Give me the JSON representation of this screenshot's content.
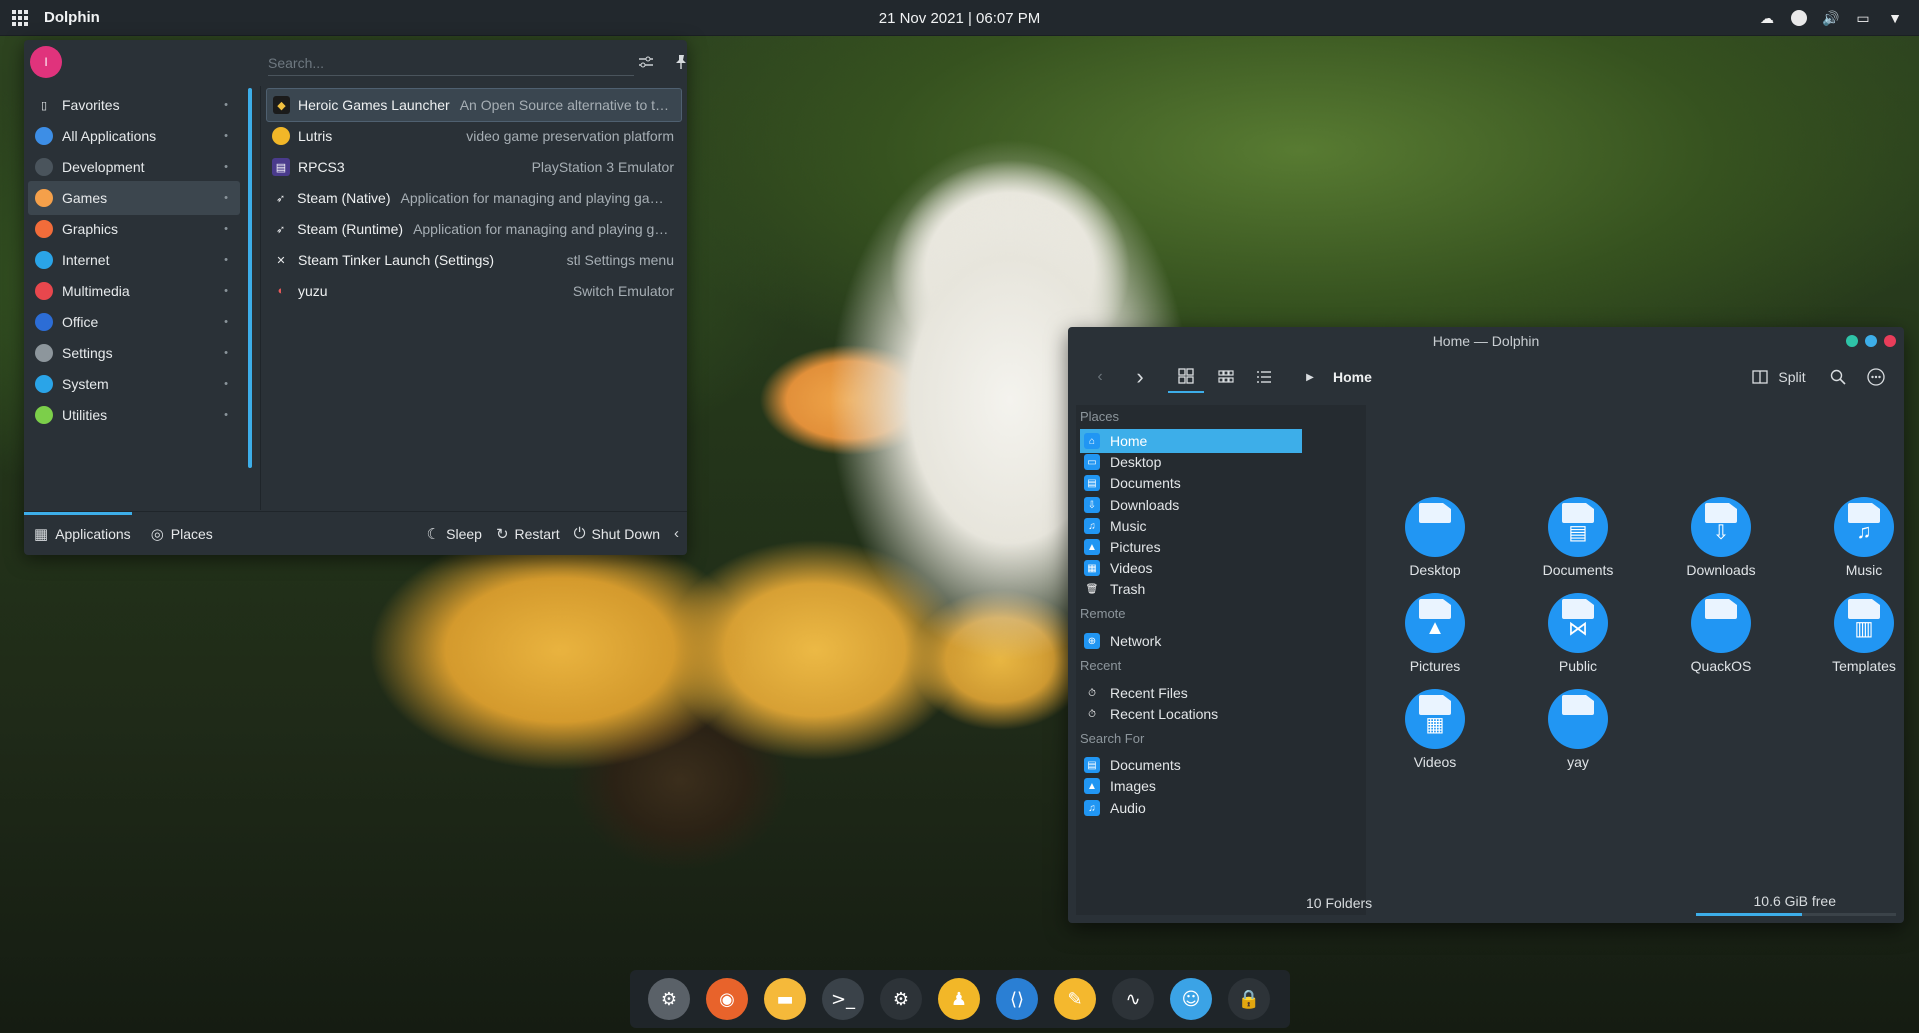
{
  "top_panel": {
    "active_app": "Dolphin",
    "clock": "21 Nov 2021 | 06:07 PM",
    "icons": [
      "app-grid-icon",
      "cloud-icon",
      "steam-tray-icon",
      "volume-icon",
      "display-icon",
      "chevron-down-icon"
    ]
  },
  "launcher": {
    "avatar_initial": "I",
    "search_placeholder": "Search...",
    "categories": [
      {
        "label": "Favorites",
        "icon": "bookmark-icon",
        "color": "#2a3137"
      },
      {
        "label": "All Applications",
        "icon": "grid-icon",
        "color": "#3d8ee6"
      },
      {
        "label": "Development",
        "icon": "development-icon",
        "color": "#4a545c"
      },
      {
        "label": "Games",
        "icon": "games-icon",
        "color": "#f5a04a"
      },
      {
        "label": "Graphics",
        "icon": "graphics-icon",
        "color": "#f26c3a"
      },
      {
        "label": "Internet",
        "icon": "internet-icon",
        "color": "#2aa4e8"
      },
      {
        "label": "Multimedia",
        "icon": "multimedia-icon",
        "color": "#e8474d"
      },
      {
        "label": "Office",
        "icon": "office-icon",
        "color": "#2c6dd6"
      },
      {
        "label": "Settings",
        "icon": "settings-icon",
        "color": "#8d969c"
      },
      {
        "label": "System",
        "icon": "system-icon",
        "color": "#2aa4e8"
      },
      {
        "label": "Utilities",
        "icon": "utilities-icon",
        "color": "#7ccf4a"
      }
    ],
    "selected_category": "Games",
    "apps": [
      {
        "name": "Heroic Games Launcher",
        "desc": "An Open Source alternative to the ...",
        "icon": "heroic-icon",
        "color": "#1b1b1b"
      },
      {
        "name": "Lutris",
        "desc": "video game preservation platform",
        "icon": "lutris-icon",
        "color": "#f2b728"
      },
      {
        "name": "RPCS3",
        "desc": "PlayStation 3 Emulator",
        "icon": "rpcs3-icon",
        "color": "#4a3b8c"
      },
      {
        "name": "Steam (Native)",
        "desc": "Application for managing and playing games...",
        "icon": "steam-icon",
        "color": "#2a3137"
      },
      {
        "name": "Steam (Runtime)",
        "desc": "Application for managing and playing gam...",
        "icon": "steam-icon",
        "color": "#2a3137"
      },
      {
        "name": "Steam Tinker Launch (Settings)",
        "desc": "stl Settings menu",
        "icon": "steam-tinker-icon",
        "color": "#2a3137"
      },
      {
        "name": "yuzu",
        "desc": "Switch Emulator",
        "icon": "yuzu-icon",
        "color": "#2a3137"
      }
    ],
    "footer": {
      "applications": "Applications",
      "places": "Places",
      "sleep": "Sleep",
      "restart": "Restart",
      "shutdown": "Shut Down"
    }
  },
  "dolphin": {
    "title": "Home — Dolphin",
    "breadcrumb": "Home",
    "split_label": "Split",
    "places_sections": [
      {
        "header": "Places",
        "items": [
          "Home",
          "Desktop",
          "Documents",
          "Downloads",
          "Music",
          "Pictures",
          "Videos",
          "Trash"
        ]
      },
      {
        "header": "Remote",
        "items": [
          "Network"
        ]
      },
      {
        "header": "Recent",
        "items": [
          "Recent Files",
          "Recent Locations"
        ]
      },
      {
        "header": "Search For",
        "items": [
          "Documents",
          "Images",
          "Audio"
        ]
      }
    ],
    "active_place": "Home",
    "folders": [
      {
        "name": "Desktop",
        "glyph": ""
      },
      {
        "name": "Documents",
        "glyph": "▤"
      },
      {
        "name": "Downloads",
        "glyph": "⇩"
      },
      {
        "name": "Music",
        "glyph": "♫"
      },
      {
        "name": "Pictures",
        "glyph": "▲"
      },
      {
        "name": "Public",
        "glyph": "⋈"
      },
      {
        "name": "QuackOS",
        "glyph": ""
      },
      {
        "name": "Templates",
        "glyph": "▥"
      },
      {
        "name": "Videos",
        "glyph": "▦"
      },
      {
        "name": "yay",
        "glyph": ""
      }
    ],
    "status_count": "10 Folders",
    "status_free": "10.6 GiB free",
    "disk_used_fraction": 0.53
  },
  "dock": [
    {
      "name": "system-settings",
      "icon": "settings-gear-icon",
      "color": "#5a6168",
      "glyph": "⚙"
    },
    {
      "name": "firefox",
      "icon": "firefox-icon",
      "color": "#e8632b",
      "glyph": "◉"
    },
    {
      "name": "dolphin",
      "icon": "folder-icon",
      "color": "#f5b93a",
      "glyph": "▬"
    },
    {
      "name": "konsole",
      "icon": "terminal-icon",
      "color": "#3a4249",
      "glyph": ">_"
    },
    {
      "name": "steam",
      "icon": "steam-icon",
      "color": "#2d3338",
      "glyph": "⚙"
    },
    {
      "name": "lutris",
      "icon": "lutris-icon",
      "color": "#f2b728",
      "glyph": "♟"
    },
    {
      "name": "vscode",
      "icon": "vscode-icon",
      "color": "#2a7fd4",
      "glyph": "⟨⟩"
    },
    {
      "name": "kate",
      "icon": "pencil-icon",
      "color": "#f4b82e",
      "glyph": "✎"
    },
    {
      "name": "steam-tinker",
      "icon": "tinker-icon",
      "color": "#2d3338",
      "glyph": "∿"
    },
    {
      "name": "discord",
      "icon": "discord-icon",
      "color": "#3ba3e6",
      "glyph": "☺"
    },
    {
      "name": "lock",
      "icon": "lock-icon",
      "color": "#2d3338",
      "glyph": "🔒"
    }
  ]
}
